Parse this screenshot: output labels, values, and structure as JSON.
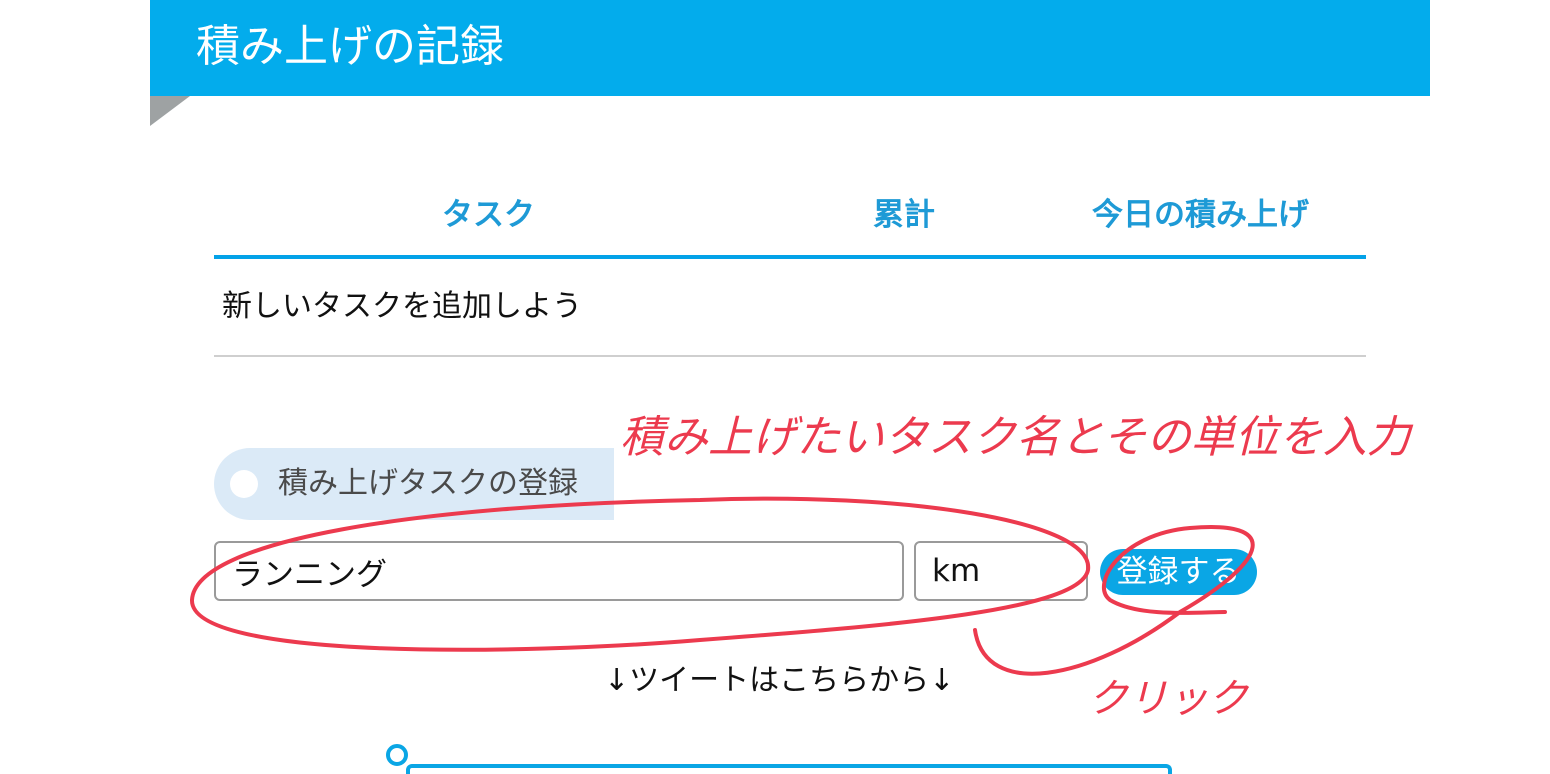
{
  "header": {
    "title": "積み上げの記録"
  },
  "table": {
    "columns": [
      "タスク",
      "累計",
      "今日の積み上げ"
    ],
    "empty_row": "新しいタスクを追加しよう"
  },
  "register": {
    "section_label": "積み上げタスクの登録",
    "task_value": "ランニング",
    "unit_value": "km",
    "button_label": "登録する"
  },
  "tweet_note": "↓ツイートはこちらから↓",
  "annotations": {
    "instruction": "積み上げたいタスク名とその単位を入力",
    "click": "クリック",
    "color": "#ec3a4e"
  },
  "colors": {
    "header_bg": "#03acec",
    "accent": "#03a2e8",
    "column_header": "#1e9ad6",
    "section_label_bg": "#dbeaf7",
    "button_bg": "#0aa6e5"
  }
}
